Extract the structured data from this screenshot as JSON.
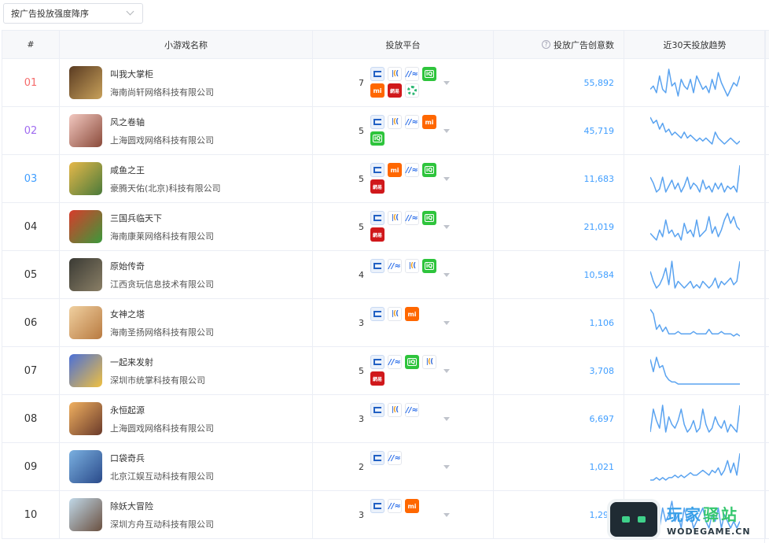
{
  "sort_select": {
    "label": "按广告投放强度降序"
  },
  "table": {
    "headers": {
      "rank": "#",
      "name": "小游戏名称",
      "platform": "投放平台",
      "count": "投放广告创意数",
      "trend": "近30天投放趋势"
    },
    "rows": [
      {
        "rank": "01",
        "name": "叫我大掌柜",
        "company": "海南尚轩网络科技有限公司",
        "platform_count": "7",
        "platforms": [
          "toutiao",
          "tencent",
          "baidu",
          "iqiyi",
          "mi",
          "netease",
          "uc"
        ],
        "creatives": "55,892",
        "trend": [
          5,
          6,
          4,
          9,
          5,
          4,
          11,
          6,
          7,
          3,
          8,
          6,
          5,
          8,
          4,
          9,
          7,
          5,
          6,
          4,
          8,
          5,
          10,
          7,
          5,
          3,
          5,
          7,
          6,
          9
        ]
      },
      {
        "rank": "02",
        "name": "风之卷轴",
        "company": "上海圆戏网络科技有限公司",
        "platform_count": "5",
        "platforms": [
          "toutiao",
          "tencent",
          "baidu",
          "mi",
          "iqiyi"
        ],
        "creatives": "45,719",
        "trend": [
          11,
          9,
          10,
          7,
          9,
          6,
          7,
          5,
          6,
          5,
          4,
          6,
          4,
          5,
          4,
          3,
          4,
          3,
          4,
          3,
          2,
          6,
          4,
          3,
          2,
          3,
          4,
          3,
          2,
          3
        ]
      },
      {
        "rank": "03",
        "name": "咸鱼之王",
        "company": "豪腾天佑(北京)科技有限公司",
        "platform_count": "5",
        "platforms": [
          "toutiao",
          "mi",
          "baidu",
          "iqiyi",
          "netease"
        ],
        "creatives": "11,683",
        "trend": [
          8,
          6,
          3,
          4,
          8,
          3,
          5,
          7,
          4,
          6,
          3,
          5,
          8,
          4,
          6,
          5,
          3,
          7,
          4,
          5,
          3,
          6,
          4,
          6,
          3,
          5,
          4,
          5,
          3,
          12
        ]
      },
      {
        "rank": "04",
        "name": "三国兵临天下",
        "company": "海南康莱网络科技有限公司",
        "platform_count": "5",
        "platforms": [
          "toutiao",
          "tencent",
          "baidu",
          "iqiyi",
          "netease"
        ],
        "creatives": "21,019",
        "trend": [
          5,
          4,
          3,
          6,
          4,
          9,
          5,
          6,
          4,
          5,
          3,
          8,
          5,
          6,
          4,
          9,
          4,
          5,
          6,
          10,
          5,
          7,
          4,
          6,
          9,
          11,
          8,
          10,
          7,
          6
        ]
      },
      {
        "rank": "05",
        "name": "原始传奇",
        "company": "江西贪玩信息技术有限公司",
        "platform_count": "4",
        "platforms": [
          "toutiao",
          "baidu",
          "tencent",
          "iqiyi"
        ],
        "creatives": "10,584",
        "trend": [
          8,
          5,
          3,
          4,
          6,
          9,
          4,
          11,
          3,
          5,
          4,
          3,
          4,
          5,
          3,
          4,
          3,
          5,
          4,
          3,
          4,
          6,
          3,
          5,
          4,
          5,
          6,
          4,
          5,
          11
        ]
      },
      {
        "rank": "06",
        "name": "女神之塔",
        "company": "海南圣扬网络科技有限公司",
        "platform_count": "3",
        "platforms": [
          "toutiao",
          "tencent",
          "mi"
        ],
        "creatives": "1,106",
        "trend": [
          14,
          12,
          5,
          7,
          4,
          6,
          3,
          3,
          3,
          4,
          3,
          3,
          3,
          3,
          4,
          3,
          3,
          3,
          3,
          5,
          3,
          3,
          3,
          4,
          3,
          3,
          3,
          2,
          3,
          2
        ]
      },
      {
        "rank": "07",
        "name": "一起来发射",
        "company": "深圳市统掌科技有限公司",
        "platform_count": "5",
        "platforms": [
          "toutiao",
          "baidu",
          "iqiyi",
          "tencent",
          "netease"
        ],
        "creatives": "3,708",
        "trend": [
          12,
          6,
          13,
          8,
          9,
          4,
          2,
          1,
          1,
          0,
          0,
          0,
          0,
          0,
          0,
          0,
          0,
          0,
          0,
          0,
          0,
          0,
          0,
          0,
          0,
          0,
          0,
          0,
          0,
          0
        ]
      },
      {
        "rank": "08",
        "name": "永恒起源",
        "company": "上海圆戏网络科技有限公司",
        "platform_count": "3",
        "platforms": [
          "toutiao",
          "tencent",
          "baidu"
        ],
        "creatives": "6,697",
        "trend": [
          3,
          9,
          6,
          4,
          10,
          3,
          7,
          5,
          4,
          6,
          9,
          5,
          3,
          4,
          6,
          3,
          4,
          9,
          5,
          3,
          4,
          7,
          5,
          4,
          6,
          3,
          5,
          4,
          3,
          10
        ]
      },
      {
        "rank": "09",
        "name": "口袋奇兵",
        "company": "北京江娱互动科技有限公司",
        "platform_count": "2",
        "platforms": [
          "toutiao",
          "baidu"
        ],
        "creatives": "1,021",
        "trend": [
          1,
          1,
          2,
          1,
          2,
          1,
          2,
          2,
          3,
          2,
          3,
          2,
          3,
          4,
          3,
          3,
          4,
          5,
          4,
          3,
          5,
          4,
          6,
          3,
          5,
          9,
          4,
          8,
          3,
          12
        ]
      },
      {
        "rank": "10",
        "name": "除妖大冒险",
        "company": "深圳方舟互动科技有限公司",
        "platform_count": "3",
        "platforms": [
          "toutiao",
          "baidu",
          "mi"
        ],
        "creatives": "1,292",
        "trend": [
          6,
          4,
          5,
          3,
          6,
          4,
          5,
          7,
          4,
          5,
          3,
          6,
          4,
          5,
          3,
          4,
          5,
          6,
          4,
          3,
          5,
          4,
          6,
          3,
          5,
          4,
          3,
          4,
          3,
          4
        ]
      }
    ]
  },
  "colors": {
    "accent": "#409eff",
    "rank1": "#f56c6c",
    "rank2": "#a06cf0",
    "rank3": "#409eff",
    "trend_line": "#5aa3f0"
  },
  "watermark": {
    "cn_part1": "玩家",
    "cn_part2": "驿站",
    "en": "WODEGAME.CN"
  }
}
